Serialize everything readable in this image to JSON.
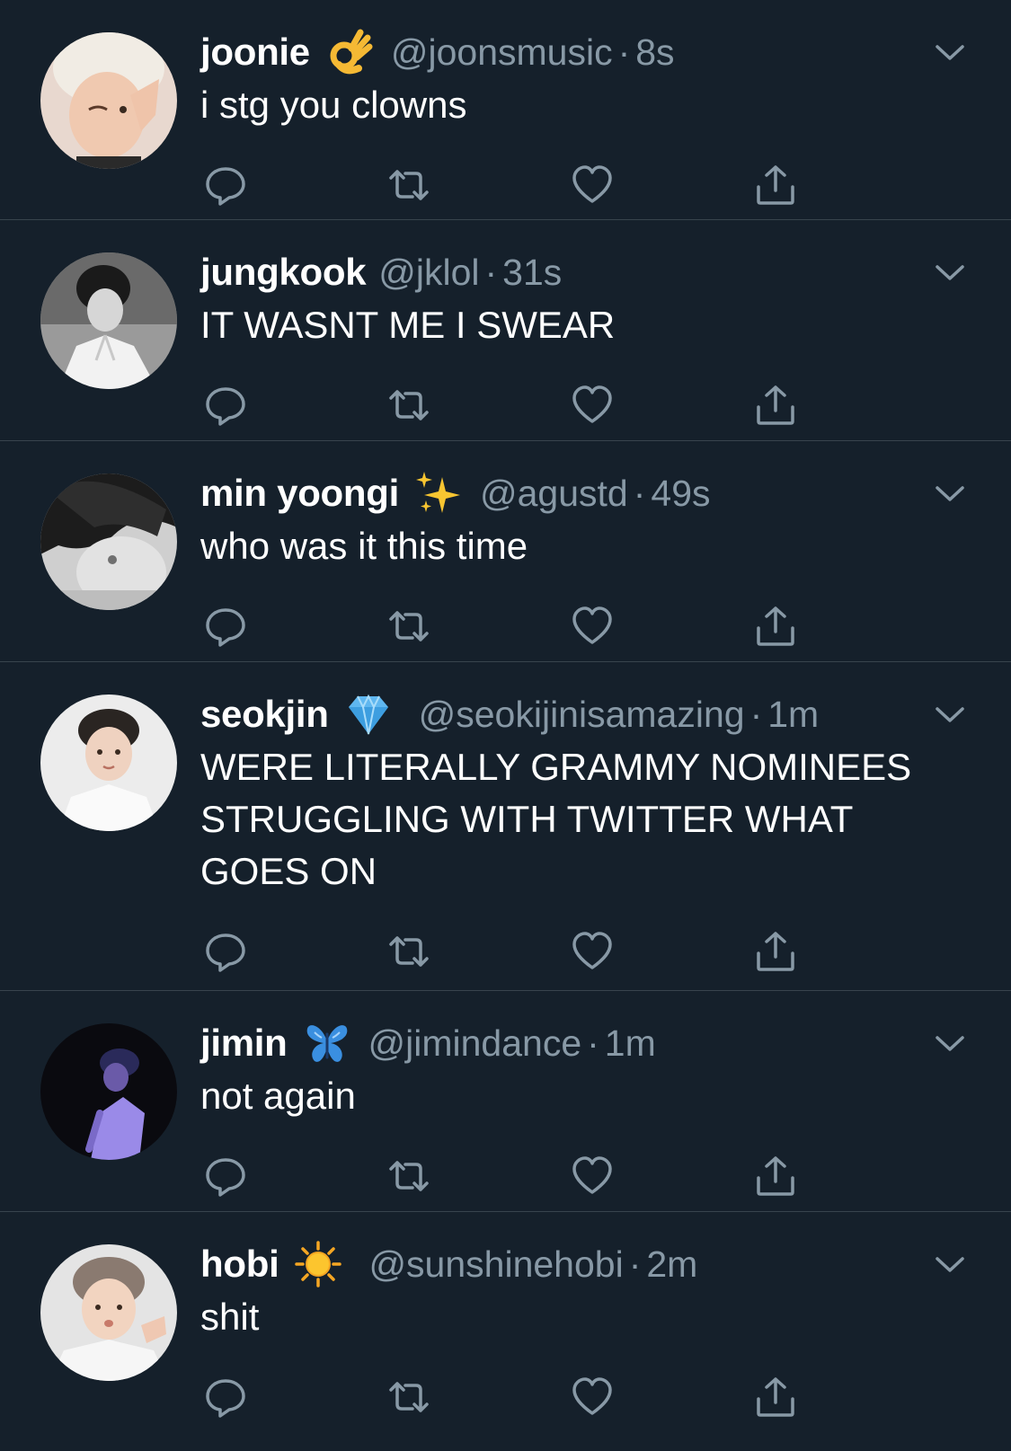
{
  "theme": {
    "background": "#15202b",
    "divider": "#38444d",
    "secondary_text": "#8899a6",
    "icon_color": "#8899a6"
  },
  "tweets": [
    {
      "name": "joonie",
      "emoji": "ok-hand-emoji",
      "handle": "@joonsmusic",
      "separator": "·",
      "time": "8s",
      "text": "i stg you clowns",
      "avatar": "avatar-joonie"
    },
    {
      "name": "jungkook",
      "emoji": "",
      "handle": "@jklol",
      "separator": "·",
      "time": "31s",
      "text": "IT WASNT ME I SWEAR",
      "avatar": "avatar-jungkook"
    },
    {
      "name": "min yoongi",
      "emoji": "sparkles-emoji",
      "handle": "@agustd",
      "separator": "·",
      "time": "49s",
      "text": "who was it this time",
      "avatar": "avatar-min-yoongi"
    },
    {
      "name": "seokjin",
      "emoji": "gem-emoji",
      "handle": "@seokijinisamazing",
      "separator": "·",
      "time": "1m",
      "text": "WERE LITERALLY GRAMMY NOMINEES STRUGGLING WITH TWITTER WHAT GOES ON",
      "avatar": "avatar-seokjin"
    },
    {
      "name": "jimin",
      "emoji": "butterfly-emoji",
      "handle": "@jimindance",
      "separator": "·",
      "time": "1m",
      "text": "not again",
      "avatar": "avatar-jimin"
    },
    {
      "name": "hobi",
      "emoji": "sun-emoji",
      "handle": "@sunshinehobi",
      "separator": "·",
      "time": "2m",
      "text": "shit",
      "avatar": "avatar-hobi"
    }
  ],
  "actions": [
    "reply-icon",
    "retweet-icon",
    "like-icon",
    "share-icon"
  ]
}
